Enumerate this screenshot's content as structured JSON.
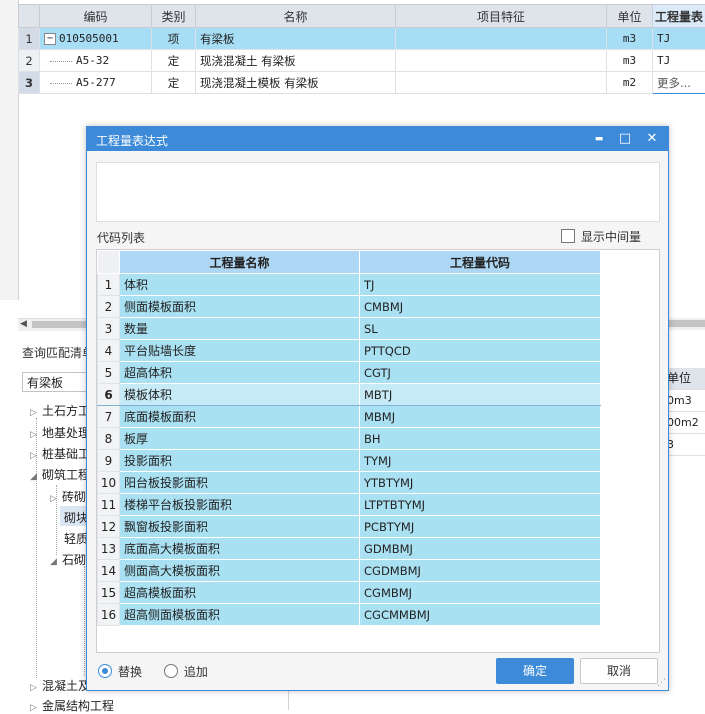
{
  "top_table": {
    "headers": [
      "编码",
      "类别",
      "名称",
      "项目特征",
      "单位",
      "工程量表"
    ],
    "rows": [
      {
        "num": "1",
        "code": "010505001",
        "type": "项",
        "name": "有梁板",
        "feature": "",
        "unit": "m3",
        "expr": "TJ"
      },
      {
        "num": "2",
        "code": "A5-32",
        "type": "定",
        "name": "现浇混凝土 有梁板",
        "feature": "",
        "unit": "m3",
        "expr": "TJ"
      },
      {
        "num": "3",
        "code": "A5-277",
        "type": "定",
        "name": "现浇混凝土模板 有梁板",
        "feature": "",
        "unit": "m2",
        "expr": "更多..."
      }
    ],
    "toggle": "−"
  },
  "left_panel": {
    "title": "查询匹配清单",
    "search_value": "有梁板",
    "tree": [
      {
        "label": "土石方工",
        "tri": "▷"
      },
      {
        "label": "地基处理",
        "tri": "▷"
      },
      {
        "label": "桩基础工",
        "tri": "▷"
      },
      {
        "label": "砌筑工程",
        "tri": "◢"
      },
      {
        "label": "砖砌",
        "tri": "▷"
      },
      {
        "label": "砌块",
        "tri": ""
      },
      {
        "label": "轻质",
        "tri": ""
      },
      {
        "label": "石砌",
        "tri": "◢"
      },
      {
        "label": "混凝土及",
        "tri": "▷"
      },
      {
        "label": "金属结构工程",
        "tri": "▷"
      }
    ]
  },
  "right_mini": {
    "header": "单位",
    "values": [
      "0m3",
      "00m2",
      "3"
    ]
  },
  "dialog": {
    "title": "工程量表达式",
    "minimize": "▬",
    "maximize": "□",
    "close": "✕",
    "code_list_label": "代码列表",
    "show_mid_label": "显示中间量",
    "col_name": "工程量名称",
    "col_code": "工程量代码",
    "rows": [
      {
        "n": "1",
        "name": "体积",
        "code": "TJ"
      },
      {
        "n": "2",
        "name": "侧面模板面积",
        "code": "CMBMJ"
      },
      {
        "n": "3",
        "name": "数量",
        "code": "SL"
      },
      {
        "n": "4",
        "name": "平台贴墙长度",
        "code": "PTTQCD"
      },
      {
        "n": "5",
        "name": "超高体积",
        "code": "CGTJ"
      },
      {
        "n": "6",
        "name": "模板体积",
        "code": "MBTJ"
      },
      {
        "n": "7",
        "name": "底面模板面积",
        "code": "MBMJ"
      },
      {
        "n": "8",
        "name": "板厚",
        "code": "BH"
      },
      {
        "n": "9",
        "name": "投影面积",
        "code": "TYMJ"
      },
      {
        "n": "10",
        "name": "阳台板投影面积",
        "code": "YTBTYMJ"
      },
      {
        "n": "11",
        "name": "楼梯平台板投影面积",
        "code": "LTPTBTYMJ"
      },
      {
        "n": "12",
        "name": "飘窗板投影面积",
        "code": "PCBTYMJ"
      },
      {
        "n": "13",
        "name": "底面高大模板面积",
        "code": "GDMBMJ"
      },
      {
        "n": "14",
        "name": "侧面高大模板面积",
        "code": "CGDMBMJ"
      },
      {
        "n": "15",
        "name": "超高模板面积",
        "code": "CGMBMJ"
      },
      {
        "n": "16",
        "name": "超高侧面模板面积",
        "code": "CGCMMBMJ"
      }
    ],
    "radio_replace": "替换",
    "radio_append": "追加",
    "ok": "确定",
    "cancel": "取消"
  }
}
